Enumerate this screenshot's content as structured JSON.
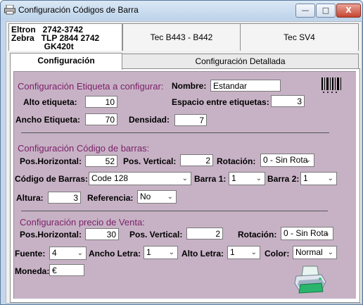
{
  "window": {
    "title": "Configuración Códigos de Barra",
    "minimize_label": "—",
    "maximize_label": "□",
    "close_label": "X"
  },
  "printer_tabs": [
    {
      "label": "Eltron   2742-3742\nZebra   TLP 2844 2742\n              GK420t"
    },
    {
      "label": "Tec B443 - B442"
    },
    {
      "label": "Tec SV4"
    }
  ],
  "sub_tabs": [
    {
      "label": "Configuración",
      "active": true
    },
    {
      "label": "Configuración Detallada",
      "active": false
    }
  ],
  "label_config": {
    "section_title": "Configuración Etiqueta a configurar:",
    "name_label": "Nombre:",
    "name_value": "Estandar",
    "height_label": "Alto etiqueta:",
    "height_value": "10",
    "spacing_label": "Espacio entre etiquetas:",
    "spacing_value": "3",
    "width_label": "Ancho Etiqueta:",
    "width_value": "70",
    "density_label": "Densidad:",
    "density_value": "7"
  },
  "barcode_config": {
    "section_title": "Configuración Código de barras:",
    "pos_h_label": "Pos.Horizontal:",
    "pos_h_value": "52",
    "pos_v_label": "Pos. Vertical:",
    "pos_v_value": "2",
    "rotation_label": "Rotación:",
    "rotation_value": "0 - Sin Rota",
    "code_label": "Código de Barras:",
    "code_value": "Code 128",
    "bar1_label": "Barra 1:",
    "bar1_value": "1",
    "bar2_label": "Barra 2:",
    "bar2_value": "1",
    "height_label": "Altura:",
    "height_value": "3",
    "ref_label": "Referencia:",
    "ref_value": "No"
  },
  "price_config": {
    "section_title": "Configuración precio de Venta:",
    "pos_h_label": "Pos.Horizontal:",
    "pos_h_value": "30",
    "pos_v_label": "Pos. Vertical:",
    "pos_v_value": "2",
    "rotation_label": "Rotación:",
    "rotation_value": "0 - Sin Rota",
    "font_label": "Fuente:",
    "font_value": "4",
    "letter_width_label": "Ancho Letra:",
    "letter_width_value": "1",
    "letter_height_label": "Alto Letra:",
    "letter_height_value": "1",
    "color_label": "Color:",
    "color_value": "Normal",
    "currency_label": "Moneda:",
    "currency_value": "€"
  },
  "icons": {
    "app": "printer-app-icon",
    "barcode": "barcode-icon",
    "print": "printer-icon"
  },
  "colors": {
    "form_background": "#c7b2c5",
    "section_title": "#7a1f68",
    "close_button": "#c6452f"
  }
}
